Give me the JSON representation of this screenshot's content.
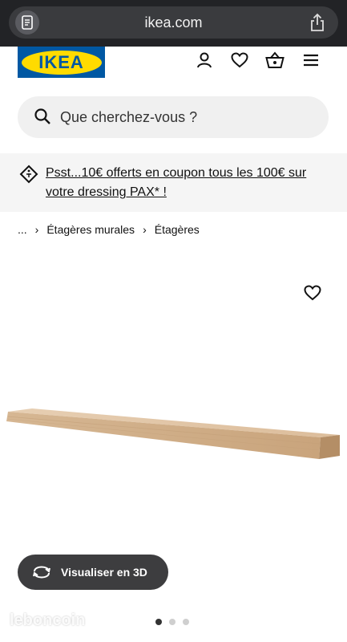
{
  "browser": {
    "url": "ikea.com",
    "reader_icon": "reader-icon",
    "share_icon": "share-icon"
  },
  "header": {
    "logo_text": "IKEA",
    "icons": [
      "account-icon",
      "heart-icon",
      "basket-icon",
      "menu-icon"
    ]
  },
  "search": {
    "placeholder": "Que cherchez-vous ?"
  },
  "promo": {
    "text": "Psst...10€ offerts en coupon tous les 100€ sur votre dressing PAX* !"
  },
  "breadcrumb": {
    "ellipsis": "...",
    "items": [
      "Étagères murales",
      "Étagères"
    ]
  },
  "gallery": {
    "button_3d": "Visualiser en 3D",
    "dots_total": 3,
    "dot_active": 1
  },
  "watermark": "leboncoin",
  "colors": {
    "ikea_blue": "#0058a3",
    "ikea_yellow": "#ffdb00",
    "button_dark": "#3d3d3f"
  }
}
